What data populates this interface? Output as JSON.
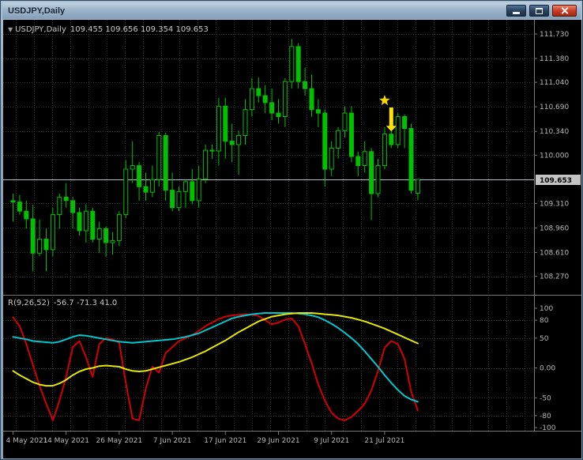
{
  "window": {
    "title": "USDJPY,Daily",
    "controls": [
      "minimize",
      "maximize",
      "close"
    ]
  },
  "icons": {
    "collapse_glyph": "▼"
  },
  "chart": {
    "symbol_label": "USDJPY,Daily",
    "ohlc_text": "109.455 109.656 109.354 109.653",
    "indicator_label": "R(9,26,52)",
    "indicator_values": "-56.7 -71.3 41.0",
    "current_price_tag": "109.653"
  },
  "colors": {
    "background": "#000000",
    "grid": "#303030",
    "separator": "#787878",
    "axis_text": "#b8b8b8",
    "candle": "#00c000",
    "candle_up_fill": "#000000",
    "bid_line": "#aec3cf",
    "price_tag_bg": "#c4c4c4",
    "price_tag_text": "#000000",
    "indicator_red": "#d40000",
    "indicator_cyan": "#00c8d0",
    "indicator_yellow": "#e6e600",
    "marker_yellow": "#ffd700"
  },
  "chart_data": {
    "type": "candlestick",
    "symbol": "USDJPY",
    "timeframe": "Daily",
    "current_price": 109.653,
    "current_bar_ohlc": [
      109.455,
      109.656,
      109.354,
      109.653
    ],
    "price_gridlines": [
      111.73,
      111.38,
      111.04,
      110.69,
      110.34,
      110.0,
      109.65,
      109.31,
      108.96,
      108.61,
      108.27
    ],
    "price_axis": [
      {
        "v": 111.73,
        "label": "111.730"
      },
      {
        "v": 111.38,
        "label": "111.380"
      },
      {
        "v": 111.04,
        "label": "111.040"
      },
      {
        "v": 110.69,
        "label": "110.690"
      },
      {
        "v": 110.34,
        "label": "110.340"
      },
      {
        "v": 110.0,
        "label": "110.000"
      },
      {
        "v": 109.31,
        "label": "109.310"
      },
      {
        "v": 108.96,
        "label": "108.960"
      },
      {
        "v": 108.61,
        "label": "108.610"
      },
      {
        "v": 108.27,
        "label": "108.270"
      }
    ],
    "time_axis": [
      {
        "i": 0,
        "label": "4 May 2021"
      },
      {
        "i": 8,
        "label": "14 May 2021"
      },
      {
        "i": 16,
        "label": "26 May 2021"
      },
      {
        "i": 24,
        "label": "7 Jun 2021"
      },
      {
        "i": 32,
        "label": "17 Jun 2021"
      },
      {
        "i": 40,
        "label": "29 Jun 2021"
      },
      {
        "i": 48,
        "label": "9 Jul 2021"
      },
      {
        "i": 56,
        "label": "21 Jul 2021"
      }
    ],
    "candles_ohlc": [
      [
        109.35,
        109.45,
        109.05,
        109.33
      ],
      [
        109.33,
        109.43,
        109.15,
        109.2
      ],
      [
        109.2,
        109.35,
        108.95,
        109.09
      ],
      [
        109.09,
        109.29,
        108.34,
        108.6
      ],
      [
        108.6,
        109.08,
        108.56,
        108.8
      ],
      [
        108.8,
        108.95,
        108.34,
        108.65
      ],
      [
        108.65,
        109.25,
        108.55,
        109.15
      ],
      [
        109.15,
        109.45,
        108.95,
        109.4
      ],
      [
        109.4,
        109.6,
        109.25,
        109.35
      ],
      [
        109.35,
        109.4,
        108.95,
        109.18
      ],
      [
        109.18,
        109.25,
        108.85,
        108.92
      ],
      [
        108.92,
        109.3,
        108.75,
        109.2
      ],
      [
        109.2,
        109.25,
        108.75,
        108.8
      ],
      [
        108.8,
        109.05,
        108.6,
        108.95
      ],
      [
        108.95,
        108.98,
        108.55,
        108.75
      ],
      [
        108.75,
        108.9,
        108.58,
        108.78
      ],
      [
        108.78,
        109.2,
        108.7,
        109.15
      ],
      [
        109.15,
        109.93,
        109.1,
        109.8
      ],
      [
        109.8,
        110.2,
        109.6,
        109.85
      ],
      [
        109.85,
        109.9,
        109.35,
        109.55
      ],
      [
        109.55,
        109.75,
        109.35,
        109.47
      ],
      [
        109.47,
        109.85,
        109.4,
        109.65
      ],
      [
        109.65,
        110.33,
        109.55,
        110.28
      ],
      [
        110.28,
        110.32,
        109.35,
        109.5
      ],
      [
        109.5,
        109.75,
        109.2,
        109.25
      ],
      [
        109.25,
        109.55,
        109.2,
        109.48
      ],
      [
        109.48,
        109.65,
        109.25,
        109.62
      ],
      [
        109.62,
        109.8,
        109.3,
        109.35
      ],
      [
        109.35,
        109.85,
        109.25,
        109.66
      ],
      [
        109.66,
        110.15,
        109.6,
        110.07
      ],
      [
        110.07,
        110.15,
        109.95,
        110.06
      ],
      [
        110.06,
        110.82,
        109.85,
        110.7
      ],
      [
        110.7,
        110.82,
        109.95,
        110.2
      ],
      [
        110.2,
        110.45,
        109.9,
        110.15
      ],
      [
        110.15,
        110.35,
        109.72,
        110.28
      ],
      [
        110.28,
        110.8,
        110.15,
        110.65
      ],
      [
        110.65,
        111.1,
        110.55,
        110.95
      ],
      [
        110.95,
        111.11,
        110.75,
        110.85
      ],
      [
        110.85,
        111.0,
        110.6,
        110.75
      ],
      [
        110.75,
        110.95,
        110.5,
        110.6
      ],
      [
        110.6,
        110.8,
        110.45,
        110.55
      ],
      [
        110.55,
        111.1,
        110.4,
        111.05
      ],
      [
        111.05,
        111.66,
        110.95,
        111.55
      ],
      [
        111.55,
        111.6,
        110.95,
        111.05
      ],
      [
        111.05,
        111.25,
        110.85,
        110.95
      ],
      [
        110.95,
        111.15,
        110.55,
        110.65
      ],
      [
        110.65,
        110.8,
        110.4,
        110.6
      ],
      [
        110.6,
        110.65,
        109.55,
        109.8
      ],
      [
        109.8,
        110.2,
        109.7,
        110.1
      ],
      [
        110.1,
        110.4,
        109.95,
        110.35
      ],
      [
        110.35,
        110.7,
        110.25,
        110.6
      ],
      [
        110.6,
        110.7,
        109.9,
        109.98
      ],
      [
        109.98,
        110.05,
        109.7,
        109.85
      ],
      [
        109.85,
        110.2,
        109.75,
        110.05
      ],
      [
        110.05,
        110.1,
        109.07,
        109.45
      ],
      [
        109.45,
        109.95,
        109.4,
        109.85
      ],
      [
        109.85,
        110.4,
        109.8,
        110.3
      ],
      [
        110.3,
        110.5,
        110.1,
        110.15
      ],
      [
        110.15,
        110.6,
        110.1,
        110.55
      ],
      [
        110.55,
        110.58,
        110.1,
        110.38
      ],
      [
        110.38,
        110.45,
        109.45,
        109.5
      ],
      [
        109.455,
        109.656,
        109.354,
        109.653
      ]
    ],
    "oscillator": {
      "label": "R(9,26,52)",
      "last_values": [
        -56.7,
        -71.3,
        41.0
      ],
      "range": [
        -100,
        100
      ],
      "gridlines": [
        80,
        50,
        0,
        -50,
        -80
      ],
      "axis": [
        {
          "v": 100,
          "label": "100"
        },
        {
          "v": 80,
          "label": "80"
        },
        {
          "v": 50,
          "label": "50"
        },
        {
          "v": 0,
          "label": "0.00"
        },
        {
          "v": -50,
          "label": "-50"
        },
        {
          "v": -80,
          "label": "-80"
        },
        {
          "v": -100,
          "label": "-100"
        }
      ],
      "series": [
        {
          "name": "red",
          "color": "#d40000",
          "width": 2,
          "values": [
            85,
            70,
            40,
            5,
            -30,
            -60,
            -88,
            -55,
            -15,
            35,
            45,
            18,
            -15,
            40,
            50,
            48,
            42,
            -25,
            -85,
            -88,
            -35,
            2,
            -8,
            25,
            35,
            45,
            50,
            55,
            62,
            70,
            76,
            82,
            86,
            88,
            89,
            90,
            89,
            87,
            80,
            73,
            76,
            81,
            83,
            70,
            40,
            8,
            -28,
            -55,
            -75,
            -85,
            -88,
            -82,
            -72,
            -60,
            -38,
            -5,
            34,
            45,
            40,
            15,
            -40,
            -71.3
          ]
        },
        {
          "name": "cyan",
          "color": "#00c8d0",
          "width": 2,
          "values": [
            52,
            50,
            48,
            45,
            44,
            43,
            42,
            44,
            48,
            52,
            55,
            54,
            52,
            50,
            48,
            46,
            44,
            43,
            42,
            43,
            44,
            45,
            46,
            47,
            48,
            50,
            52,
            55,
            58,
            63,
            68,
            73,
            78,
            83,
            86,
            88,
            90,
            91,
            92,
            92,
            92,
            92,
            92,
            91,
            90,
            88,
            85,
            80,
            74,
            67,
            59,
            50,
            40,
            28,
            15,
            2,
            -12,
            -25,
            -37,
            -47,
            -53,
            -56.7
          ]
        },
        {
          "name": "yellow",
          "color": "#e6e600",
          "width": 2,
          "values": [
            -5,
            -12,
            -18,
            -24,
            -28,
            -30,
            -30,
            -26,
            -20,
            -12,
            -6,
            -2,
            0,
            3,
            4,
            3,
            2,
            -2,
            -5,
            -6,
            -5,
            -2,
            1,
            4,
            7,
            10,
            14,
            18,
            23,
            28,
            34,
            40,
            46,
            53,
            60,
            66,
            72,
            78,
            82,
            86,
            88,
            90,
            91,
            92,
            92,
            92,
            91,
            90,
            89,
            88,
            86,
            84,
            81,
            78,
            74,
            70,
            66,
            61,
            56,
            51,
            46,
            41
          ]
        }
      ]
    },
    "annotations": [
      {
        "type": "star",
        "index": 56,
        "price": 110.78,
        "color": "#ffd700"
      },
      {
        "type": "arrow_down",
        "index": 57,
        "price_from": 110.68,
        "price_to": 110.34,
        "color": "#ffe400"
      }
    ]
  }
}
